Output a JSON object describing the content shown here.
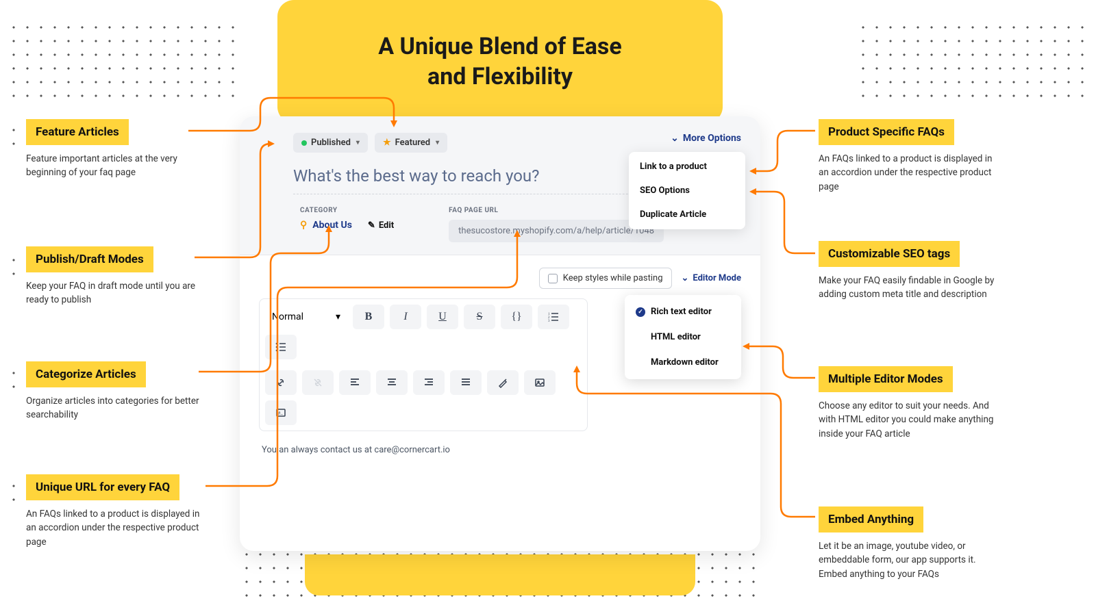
{
  "hero_title_l1": "A Unique Blend of Ease",
  "hero_title_l2": "and Flexibility",
  "badges": {
    "published": "Published",
    "featured": "Featured"
  },
  "more_options": "More Options",
  "more_options_menu": {
    "link": "Link to a product",
    "seo": "SEO Options",
    "dup": "Duplicate Article"
  },
  "article_title": "What's the best way to reach you?",
  "category_label": "CATEGORY",
  "category_value": "About Us",
  "edit_label": "Edit",
  "faq_url_label": "FAQ PAGE URL",
  "faq_url_value": "thesucostore.myshopify.com/a/help/article/1048",
  "paste_checkbox": "Keep styles while pasting",
  "editor_mode_label": "Editor Mode",
  "editor_modes": {
    "rich": "Rich text editor",
    "html": "HTML editor",
    "md": "Markdown editor"
  },
  "toolbar": {
    "format": "Normal"
  },
  "body_text": "You an always contact us at care@cornercart.io",
  "callouts": {
    "l1_title": "Feature Articles",
    "l1_desc": "Feature important articles at the very beginning of your faq page",
    "l2_title": "Publish/Draft Modes",
    "l2_desc": "Keep your FAQ in draft mode until you are ready to publish",
    "l3_title": "Categorize Articles",
    "l3_desc": "Organize articles into categories for better searchability",
    "l4_title": "Unique URL for every FAQ",
    "l4_desc": "An FAQs linked to a product is displayed in an accordion under the respective product page",
    "r1_title": "Product Specific FAQs",
    "r1_desc": "An FAQs linked to a product is displayed in an accordion under the respective product page",
    "r2_title": "Customizable SEO tags",
    "r2_desc": "Make your FAQ easily findable in Google by adding custom meta title and description",
    "r3_title": "Multiple Editor Modes",
    "r3_desc": "Choose any editor to suit your needs. And with HTML editor you could make anything inside your FAQ article",
    "r4_title": "Embed Anything",
    "r4_desc": "Let it be an image, youtube video, or embeddable form, our app supports it. Embed anything to your FAQs"
  }
}
